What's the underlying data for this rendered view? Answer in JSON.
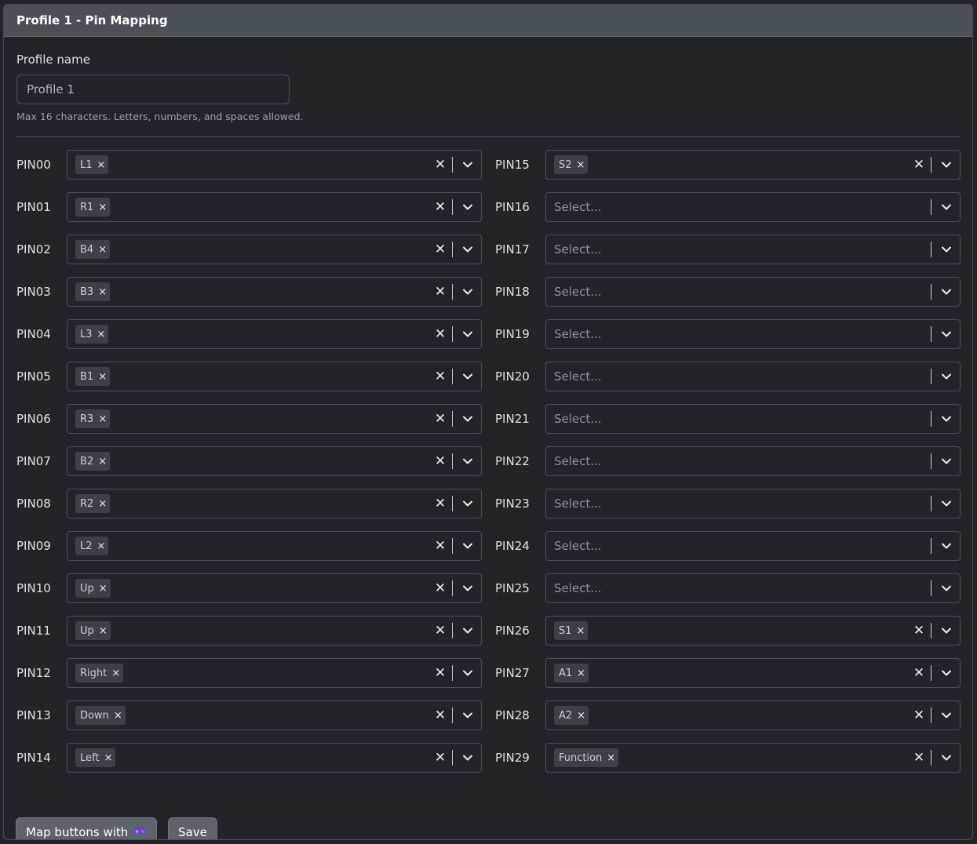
{
  "header": {
    "title": "Profile 1 - Pin Mapping"
  },
  "profile": {
    "label": "Profile name",
    "value": "Profile 1",
    "help": "Max 16 characters. Letters, numbers, and spaces allowed."
  },
  "select_placeholder": "Select...",
  "pins_left": [
    {
      "pin": "PIN00",
      "value": "L1"
    },
    {
      "pin": "PIN01",
      "value": "R1"
    },
    {
      "pin": "PIN02",
      "value": "B4"
    },
    {
      "pin": "PIN03",
      "value": "B3"
    },
    {
      "pin": "PIN04",
      "value": "L3"
    },
    {
      "pin": "PIN05",
      "value": "B1"
    },
    {
      "pin": "PIN06",
      "value": "R3"
    },
    {
      "pin": "PIN07",
      "value": "B2"
    },
    {
      "pin": "PIN08",
      "value": "R2"
    },
    {
      "pin": "PIN09",
      "value": "L2"
    },
    {
      "pin": "PIN10",
      "value": "Up"
    },
    {
      "pin": "PIN11",
      "value": "Up"
    },
    {
      "pin": "PIN12",
      "value": "Right"
    },
    {
      "pin": "PIN13",
      "value": "Down"
    },
    {
      "pin": "PIN14",
      "value": "Left"
    }
  ],
  "pins_right": [
    {
      "pin": "PIN15",
      "value": "S2"
    },
    {
      "pin": "PIN16",
      "value": ""
    },
    {
      "pin": "PIN17",
      "value": ""
    },
    {
      "pin": "PIN18",
      "value": ""
    },
    {
      "pin": "PIN19",
      "value": ""
    },
    {
      "pin": "PIN20",
      "value": ""
    },
    {
      "pin": "PIN21",
      "value": ""
    },
    {
      "pin": "PIN22",
      "value": ""
    },
    {
      "pin": "PIN23",
      "value": ""
    },
    {
      "pin": "PIN24",
      "value": ""
    },
    {
      "pin": "PIN25",
      "value": ""
    },
    {
      "pin": "PIN26",
      "value": "S1"
    },
    {
      "pin": "PIN27",
      "value": "A1"
    },
    {
      "pin": "PIN28",
      "value": "A2"
    },
    {
      "pin": "PIN29",
      "value": "Function"
    }
  ],
  "buttons": {
    "map_label": "Map buttons with",
    "map_icon": "gamepad-icon",
    "save_label": "Save"
  },
  "colors": {
    "background": "#212529",
    "header": "#4a5057",
    "chip": "#3b4148",
    "button": "#5c636a",
    "gamepad_icon": "#6f42c1"
  }
}
